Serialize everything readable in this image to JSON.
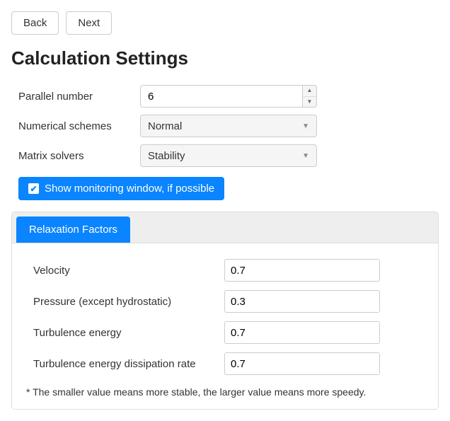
{
  "nav": {
    "back": "Back",
    "next": "Next"
  },
  "title": "Calculation Settings",
  "settings": {
    "parallel_label": "Parallel number",
    "parallel_value": "6",
    "schemes_label": "Numerical schemes",
    "schemes_value": "Normal",
    "solvers_label": "Matrix solvers",
    "solvers_value": "Stability"
  },
  "monitor": {
    "checked": true,
    "label": "Show monitoring window, if possible"
  },
  "tabs": {
    "relaxation": "Relaxation Factors"
  },
  "relax": {
    "velocity_label": "Velocity",
    "velocity_value": "0.7",
    "pressure_label": "Pressure (except hydrostatic)",
    "pressure_value": "0.3",
    "turb_energy_label": "Turbulence energy",
    "turb_energy_value": "0.7",
    "turb_diss_label": "Turbulence energy dissipation rate",
    "turb_diss_value": "0.7",
    "footnote": "* The smaller value means more stable, the larger value means more speedy."
  }
}
